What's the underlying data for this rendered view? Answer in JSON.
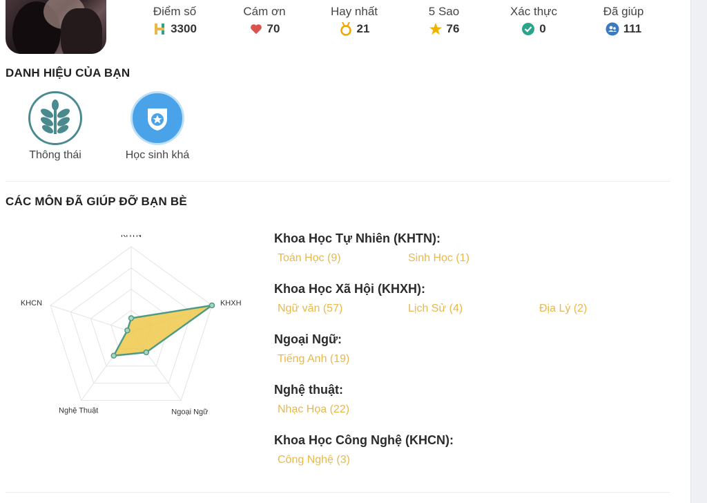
{
  "stats": [
    {
      "label": "Điểm số",
      "value": "3300",
      "icon": "score-h-icon",
      "color": "#e8b84a"
    },
    {
      "label": "Cám ơn",
      "value": "70",
      "icon": "heart-icon",
      "color": "#d9534f"
    },
    {
      "label": "Hay nhất",
      "value": "21",
      "icon": "medal-icon",
      "color": "#f0a500"
    },
    {
      "label": "5 Sao",
      "value": "76",
      "icon": "star-icon",
      "color": "#f0b400"
    },
    {
      "label": "Xác thực",
      "value": "0",
      "icon": "verified-check-icon",
      "color": "#2aa58a"
    },
    {
      "label": "Đã giúp",
      "value": "111",
      "icon": "users-group-icon",
      "color": "#3a7bbf"
    }
  ],
  "titles_section": {
    "title": "DANH HIỆU CỦA BẠN",
    "badges": [
      {
        "name": "Thông thái",
        "icon": "leaf-badge-icon",
        "color": "#4a8a8f"
      },
      {
        "name": "Học sinh khá",
        "icon": "shield-star-badge-icon",
        "color": "#4aa3e8"
      }
    ]
  },
  "subjects_section": {
    "title": "CÁC MÔN ĐÃ GIÚP ĐỠ BẠN BÈ",
    "groups": [
      {
        "title": "Khoa Học Tự Nhiên (KHTN):",
        "items": [
          "Toán Học (9)",
          "Sinh Học (1)"
        ]
      },
      {
        "title": "Khoa Học Xã Hội (KHXH):",
        "items": [
          "Ngữ văn (57)",
          "Lịch Sử (4)",
          "Địa Lý (2)"
        ]
      },
      {
        "title": "Ngoại Ngữ:",
        "items": [
          "Tiếng Anh (19)"
        ]
      },
      {
        "title": "Nghệ thuật:",
        "items": [
          "Nhạc Họa (22)"
        ]
      },
      {
        "title": "Khoa Học Công Nghệ (KHCN):",
        "items": [
          "Công Nghệ (3)"
        ]
      }
    ]
  },
  "chart_data": {
    "type": "radar",
    "axes": [
      "KHTN",
      "KHXH",
      "Ngoại Ngữ",
      "Nghệ Thuật",
      "KHCN"
    ],
    "values": [
      10,
      63,
      19,
      22,
      3
    ],
    "max": 63,
    "grid_levels": 4,
    "fill_color": "#efc94a",
    "stroke_color": "#4e9a86"
  }
}
